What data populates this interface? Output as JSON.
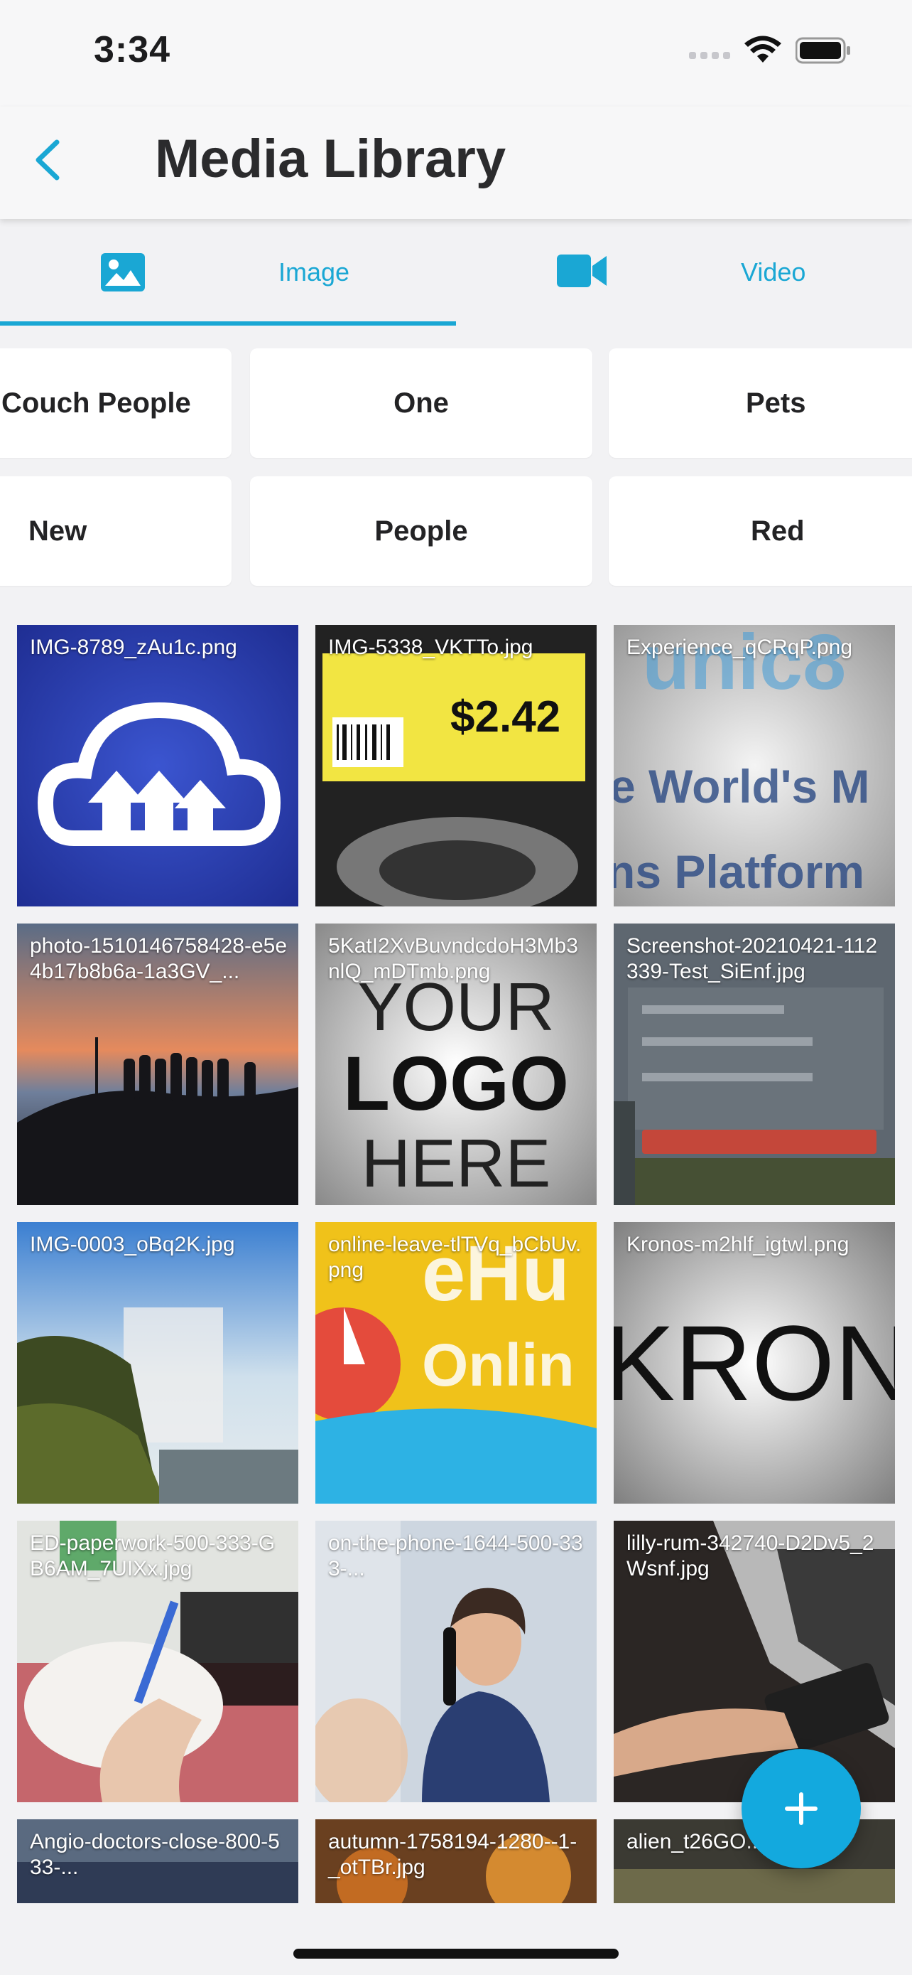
{
  "status": {
    "time": "3:34"
  },
  "header": {
    "title": "Media Library"
  },
  "tabs": [
    {
      "label": "Image"
    },
    {
      "label": "Video"
    }
  ],
  "albums": [
    {
      "label": "Couch People"
    },
    {
      "label": "One"
    },
    {
      "label": "Pets"
    },
    {
      "label": "New"
    },
    {
      "label": "People"
    },
    {
      "label": "Red"
    }
  ],
  "media": [
    {
      "name": "IMG-8789_zAu1c.png"
    },
    {
      "name": "IMG-5338_VKTTo.jpg",
      "price": "$2.42"
    },
    {
      "name": "Experience_qCRqP.png",
      "text": "e World's M"
    },
    {
      "name": "photo-1510146758428-e5e4b17b8b6a-1a3GV_..."
    },
    {
      "name": "5KatI2XvBuvndcdoH3Mb3nlQ_mDTmb.png",
      "text_lines": [
        "YOUR",
        "LOGO",
        "HERE"
      ]
    },
    {
      "name": "Screenshot-20210421-112339-Test_SiEnf.jpg"
    },
    {
      "name": "IMG-0003_oBq2K.jpg"
    },
    {
      "name": "online-leave-tlTVq_bCbUv.png",
      "text": "Onlin"
    },
    {
      "name": "Kronos-m2hlf_igtwl.png",
      "text": "KRON"
    },
    {
      "name": "ED-paperwork-500-333-GB6AM_7UIXx.jpg"
    },
    {
      "name": "on-the-phone-1644-500-333-..."
    },
    {
      "name": "lilly-rum-342740-D2Dv5_2Wsnf.jpg"
    },
    {
      "name": "Angio-doctors-close-800-533-..."
    },
    {
      "name": "autumn-1758194-1280--1-_otTBr.jpg"
    },
    {
      "name": "alien_t26GO..."
    }
  ],
  "colors": {
    "accent": "#1aa7d4",
    "fab": "#13a9de"
  }
}
